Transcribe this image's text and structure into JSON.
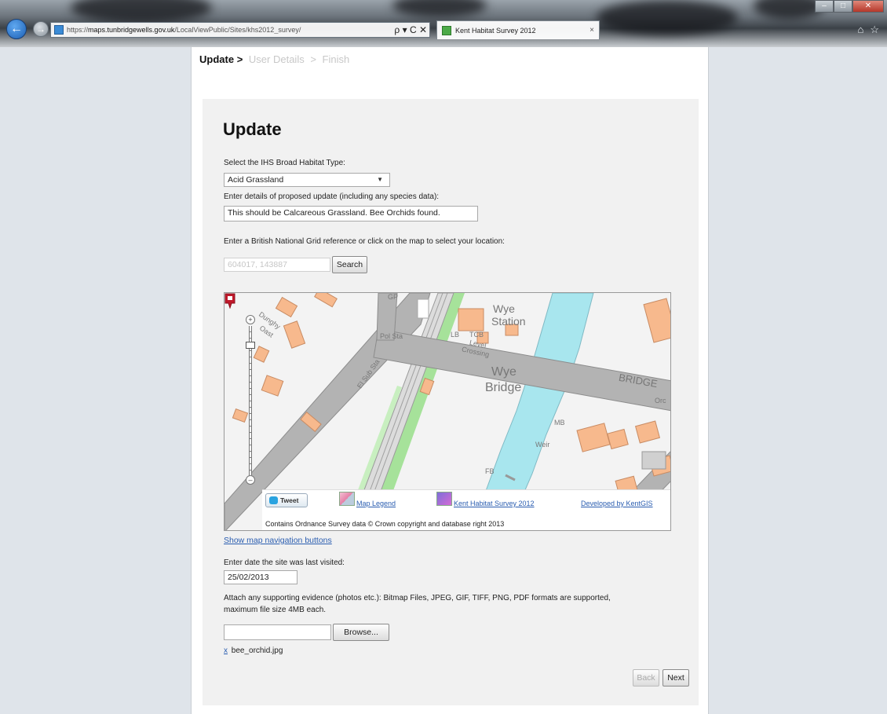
{
  "browser": {
    "url_prefix": "https://",
    "url_host": "maps.tunbridgewells.gov.uk",
    "url_path": "/LocalViewPublic/Sites/khs2012_survey/",
    "address_tools": "ρ ▾ C ✕",
    "tab_title": "Kent Habitat Survey 2012",
    "tab_close": "×"
  },
  "breadcrumb": {
    "current": "Update",
    "separator_1": ">",
    "step_2": "User Details",
    "separator_2": ">",
    "step_3": "Finish"
  },
  "form": {
    "heading": "Update",
    "habitat_label": "Select the IHS Broad Habitat Type:",
    "habitat_value": "Acid Grassland",
    "details_label": "Enter details of proposed update (including any species data):",
    "details_value": "This should be Calcareous Grassland. Bee Orchids found.",
    "grid_label": "Enter a British National Grid reference or click on the map to select your location:",
    "grid_value": "604017, 143887",
    "search_label": "Search",
    "nav_toggle": "Show map navigation buttons",
    "date_label": "Enter date the site was last visited:",
    "date_value": "25/02/2013",
    "evidence_label_line1": "Attach any supporting evidence (photos etc.): Bitmap Files, JPEG, GIF, TIFF, PNG, PDF formats are supported,",
    "evidence_label_line2": "maximum file size 4MB each.",
    "file_value": "",
    "browse_label": "Browse...",
    "attached_remove": "x",
    "attached_file": "bee_orchid.jpg",
    "back_label": "Back",
    "next_label": "Next"
  },
  "map": {
    "labels": {
      "gp": "GP",
      "wye_station_1": "Wye",
      "wye_station_2": "Station",
      "tcb": "TCB",
      "level_1": "Level",
      "level_2": "Crossing",
      "lb": "LB",
      "pol_sta": "Pol Sta",
      "wye_bridge_1": "Wye",
      "wye_bridge_2": "Bridge",
      "bridge_road": "BRIDGE",
      "dunghy_1": "Dunghy",
      "dunghy_2": "Oast",
      "mill": "MB",
      "weir": "Weir",
      "fb": "FB",
      "el_sub": "El Sub Sta",
      "works": "Orc"
    },
    "tweet_label": "Tweet",
    "legend_link": "Map Legend",
    "survey_link": "Kent Habitat Survey 2012",
    "developer_link": "Developed by KentGIS",
    "copyright": "Contains Ordnance Survey data © Crown copyright and database right 2013",
    "colors": {
      "water": "#a8e6ee",
      "building": "#f7b98d",
      "road": "#b3b3b3",
      "rail_green": "#a6e29a",
      "pin": "#c0182a"
    }
  }
}
